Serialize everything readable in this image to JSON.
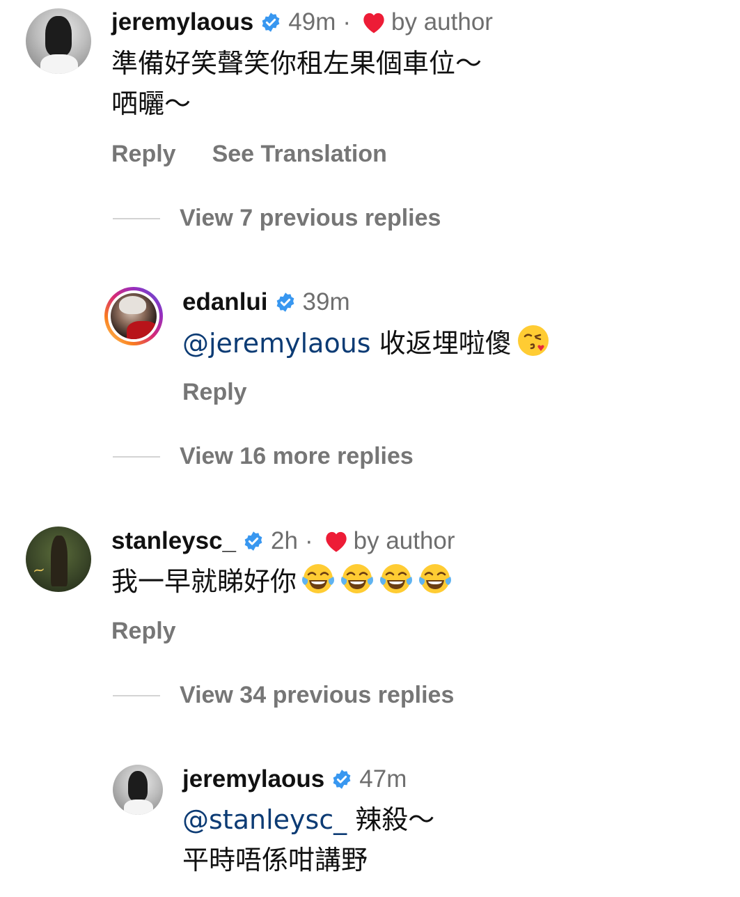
{
  "comments": [
    {
      "username": "jeremylaous",
      "time": "49m",
      "dot": "·",
      "liked_by_author": true,
      "by_author": "by author",
      "lines": [
        "準備好笑聲笑你租左果個車位～",
        "哂曬～"
      ],
      "reply_label": "Reply",
      "translate_label": "See Translation",
      "replies_toggle": "View 7 previous replies"
    },
    {
      "username": "edanlui",
      "time": "39m",
      "mention": "@jeremylaous",
      "text": "收返埋啦傻",
      "emoji": "face-blowing-a-kiss",
      "reply_label": "Reply",
      "replies_toggle": "View 16 more replies"
    },
    {
      "username": "stanleysc_",
      "time": "2h",
      "dot": "·",
      "liked_by_author": true,
      "by_author": "by author",
      "text": "我一早就睇好你",
      "emojis": [
        "face-with-tears-of-joy",
        "face-with-tears-of-joy",
        "face-with-tears-of-joy",
        "face-with-tears-of-joy"
      ],
      "reply_label": "Reply",
      "replies_toggle": "View 34 previous replies"
    },
    {
      "username": "jeremylaous",
      "time": "47m",
      "mention": "@stanleysc_",
      "line1_rest": "辣殺～",
      "line2": "平時唔係咁講野"
    }
  ],
  "colors": {
    "verified_blue": "#3897f0",
    "heart_red": "#ed1c36",
    "mention_blue": "#0c3b74",
    "muted_gray": "#767676"
  }
}
